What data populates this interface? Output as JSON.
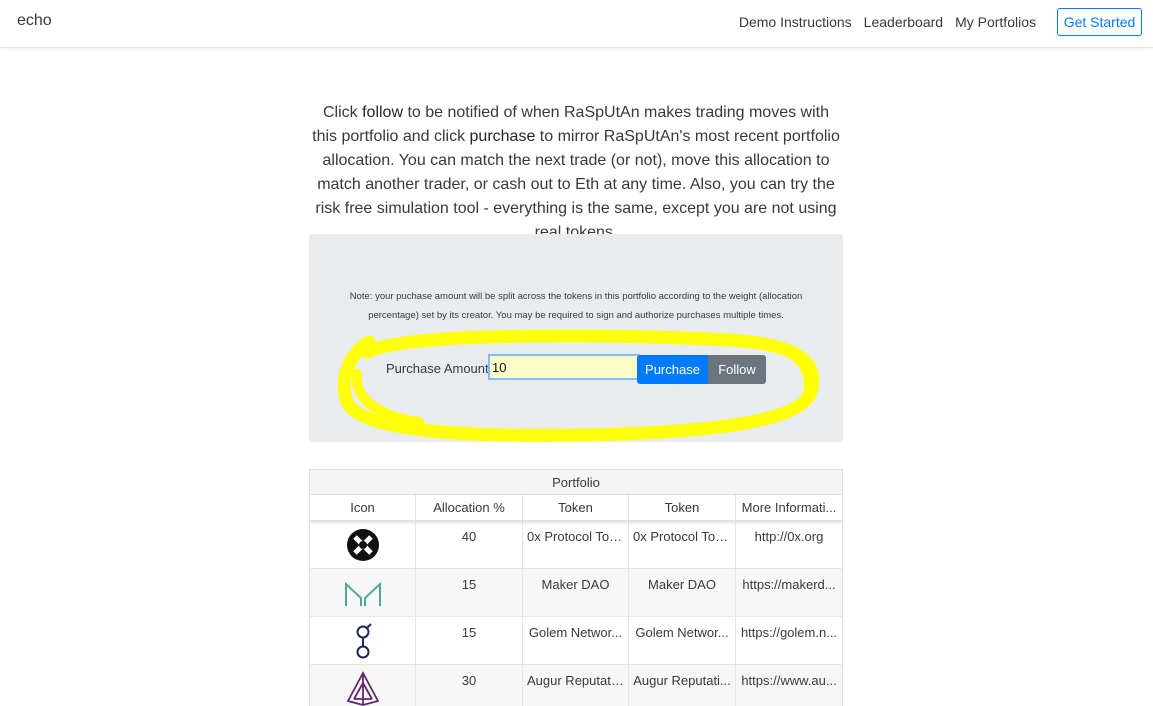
{
  "navbar": {
    "brand": "echo",
    "links": [
      "Demo Instructions",
      "Leaderboard",
      "My Portfolios"
    ],
    "cta": "Get Started",
    "cta_color": "#007bff"
  },
  "intro": {
    "p1": "Click ",
    "follow_word": "follow",
    "p2": " to be notified of when RaSpUtAn makes trading moves with this portfolio and click ",
    "purchase_word": "purchase",
    "p3": " to mirror RaSpUtAn's most recent portfolio allocation. You can match the next trade (or not), move this allocation to match another trader, or cash out to Eth at any time. Also, you can try the risk free simulation tool - everything is the same, except you are not using real tokens."
  },
  "panel": {
    "note": "Note: your puchase amount will be split across the tokens in this portfolio according to the weight (allocation percentage) set by its creator. You may be required to sign and authorize purchases multiple times.",
    "amount_label": "Purchase Amount:",
    "amount_value": "10",
    "purchase_button": "Purchase",
    "follow_button": "Follow",
    "highlight_color": "#ffff00"
  },
  "table": {
    "title": "Portfolio",
    "headers": [
      "Icon",
      "Allocation %",
      "Token",
      "Token",
      "More Informati..."
    ],
    "rows": [
      {
        "icon": "0x-protocol-icon",
        "allocation": "40",
        "token": "0x Protocol Tok...",
        "token2": "0x Protocol Tok...",
        "info": "http://0x.org"
      },
      {
        "icon": "maker-icon",
        "allocation": "15",
        "token": "Maker DAO",
        "token2": "Maker DAO",
        "info": "https://makerd..."
      },
      {
        "icon": "golem-icon",
        "allocation": "15",
        "token": "Golem Networ...",
        "token2": "Golem Networ...",
        "info": "https://golem.n..."
      },
      {
        "icon": "augur-icon",
        "allocation": "30",
        "token": "Augur Reputati...",
        "token2": "Augur Reputati...",
        "info": "https://www.au..."
      }
    ]
  }
}
